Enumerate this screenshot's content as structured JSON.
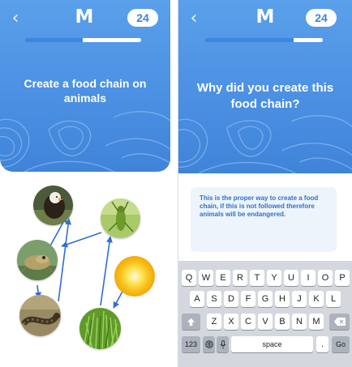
{
  "left_screen": {
    "back_icon": "chevron-left-icon",
    "logo": "M",
    "badge": "24",
    "progress_fraction": 0.5,
    "question": "Create a food chain on animals",
    "chain_items": [
      {
        "id": "eagle",
        "icon": "eagle-photo"
      },
      {
        "id": "grasshopper",
        "icon": "grasshopper-photo"
      },
      {
        "id": "frog",
        "icon": "frog-photo"
      },
      {
        "id": "sun",
        "icon": "sun-photo"
      },
      {
        "id": "snake",
        "icon": "snake-photo"
      },
      {
        "id": "grass",
        "icon": "grass-photo"
      }
    ]
  },
  "right_screen": {
    "back_icon": "chevron-left-icon",
    "logo": "M",
    "badge": "24",
    "progress_fraction": 0.75,
    "question": "Why did you create this food chain?",
    "answer": "This is the proper way to create a food chain, if this is not followed therefore animals will be endangered."
  },
  "keyboard": {
    "row1": [
      "Q",
      "W",
      "E",
      "R",
      "T",
      "Y",
      "U",
      "I",
      "O",
      "P"
    ],
    "row2": [
      "A",
      "S",
      "D",
      "F",
      "G",
      "H",
      "J",
      "K",
      "L"
    ],
    "row3": [
      "Z",
      "X",
      "C",
      "V",
      "B",
      "N",
      "M"
    ],
    "shift_icon": "shift-arrow-icon",
    "delete_icon": "backspace-icon",
    "numbers_label": "123",
    "globe_icon": "globe-icon",
    "mic_icon": "microphone-icon",
    "space_label": "space",
    "period_label": ".",
    "go_label": "Go"
  },
  "colors": {
    "header_blue": "#4a8fe2",
    "progress_fill": "#3d86e0",
    "arrow_blue": "#2f6fd0",
    "answer_text": "#2c72c9",
    "answer_bg": "#eef4fc",
    "keyboard_bg": "#d4d8de"
  }
}
